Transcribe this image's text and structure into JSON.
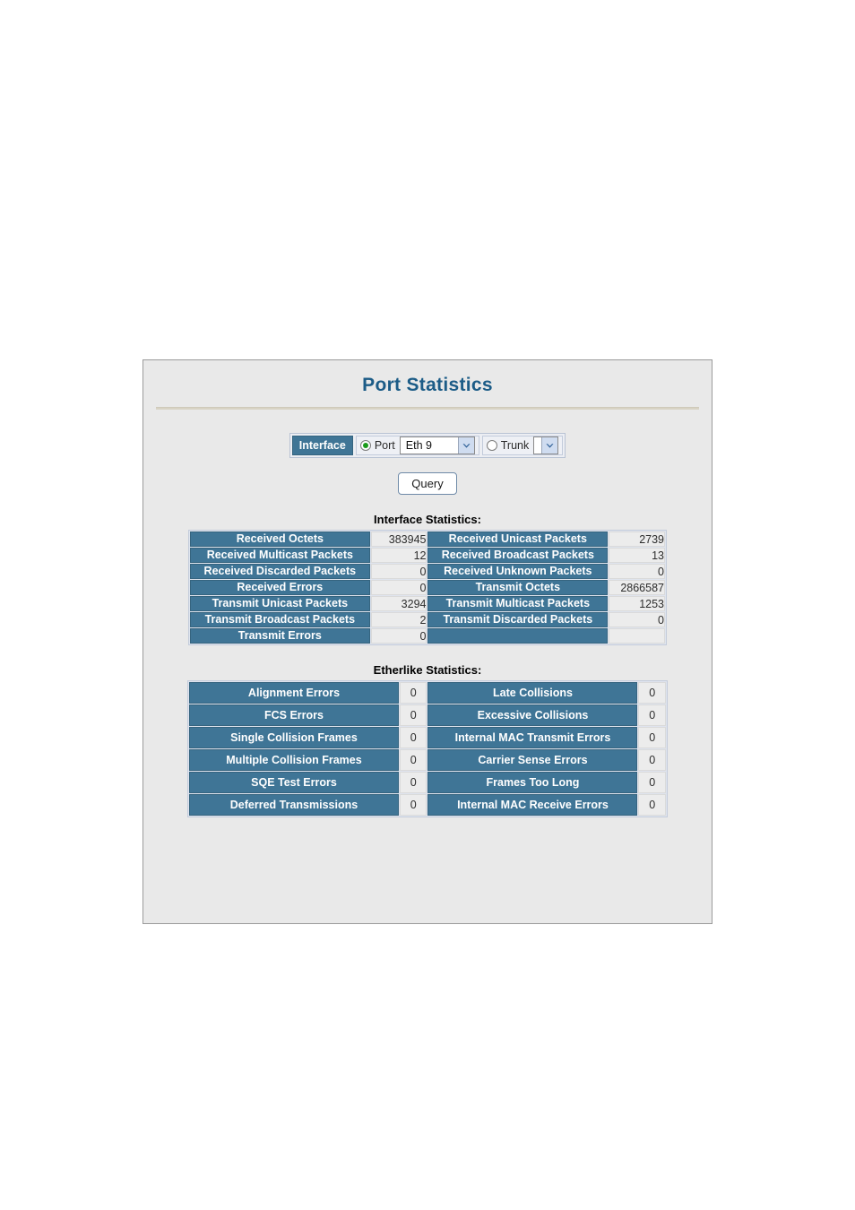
{
  "panel": {
    "title": "Port Statistics"
  },
  "interface_selector": {
    "label": "Interface",
    "port": {
      "radio_label": "Port",
      "selected": true,
      "dropdown_value": "Eth 9"
    },
    "trunk": {
      "radio_label": "Trunk",
      "selected": false,
      "dropdown_value": ""
    }
  },
  "query_button": {
    "label": "Query"
  },
  "interface_statistics": {
    "heading": "Interface Statistics:",
    "rows": [
      {
        "left_label": "Received Octets",
        "left_value": "383945",
        "right_label": "Received Unicast Packets",
        "right_value": "2739"
      },
      {
        "left_label": "Received Multicast Packets",
        "left_value": "12",
        "right_label": "Received Broadcast Packets",
        "right_value": "13"
      },
      {
        "left_label": "Received Discarded Packets",
        "left_value": "0",
        "right_label": "Received Unknown Packets",
        "right_value": "0"
      },
      {
        "left_label": "Received Errors",
        "left_value": "0",
        "right_label": "Transmit Octets",
        "right_value": "2866587"
      },
      {
        "left_label": "Transmit Unicast Packets",
        "left_value": "3294",
        "right_label": "Transmit Multicast Packets",
        "right_value": "1253"
      },
      {
        "left_label": "Transmit Broadcast Packets",
        "left_value": "2",
        "right_label": "Transmit Discarded Packets",
        "right_value": "0"
      },
      {
        "left_label": "Transmit Errors",
        "left_value": "0",
        "right_label": "",
        "right_value": ""
      }
    ]
  },
  "etherlike_statistics": {
    "heading": "Etherlike Statistics:",
    "rows": [
      {
        "left_label": "Alignment Errors",
        "left_value": "0",
        "right_label": "Late Collisions",
        "right_value": "0"
      },
      {
        "left_label": "FCS Errors",
        "left_value": "0",
        "right_label": "Excessive Collisions",
        "right_value": "0"
      },
      {
        "left_label": "Single Collision Frames",
        "left_value": "0",
        "right_label": "Internal MAC Transmit Errors",
        "right_value": "0"
      },
      {
        "left_label": "Multiple Collision Frames",
        "left_value": "0",
        "right_label": "Carrier Sense Errors",
        "right_value": "0"
      },
      {
        "left_label": "SQE Test Errors",
        "left_value": "0",
        "right_label": "Frames Too Long",
        "right_value": "0"
      },
      {
        "left_label": "Deferred Transmissions",
        "left_value": "0",
        "right_label": "Internal MAC Receive Errors",
        "right_value": "0"
      }
    ]
  },
  "colors": {
    "header_blue": "#3f7596",
    "title_blue": "#1c5c87",
    "panel_bg": "#e9e9e9",
    "value_bg": "#ececec",
    "radio_selected_dot": "#1a9a1a"
  }
}
